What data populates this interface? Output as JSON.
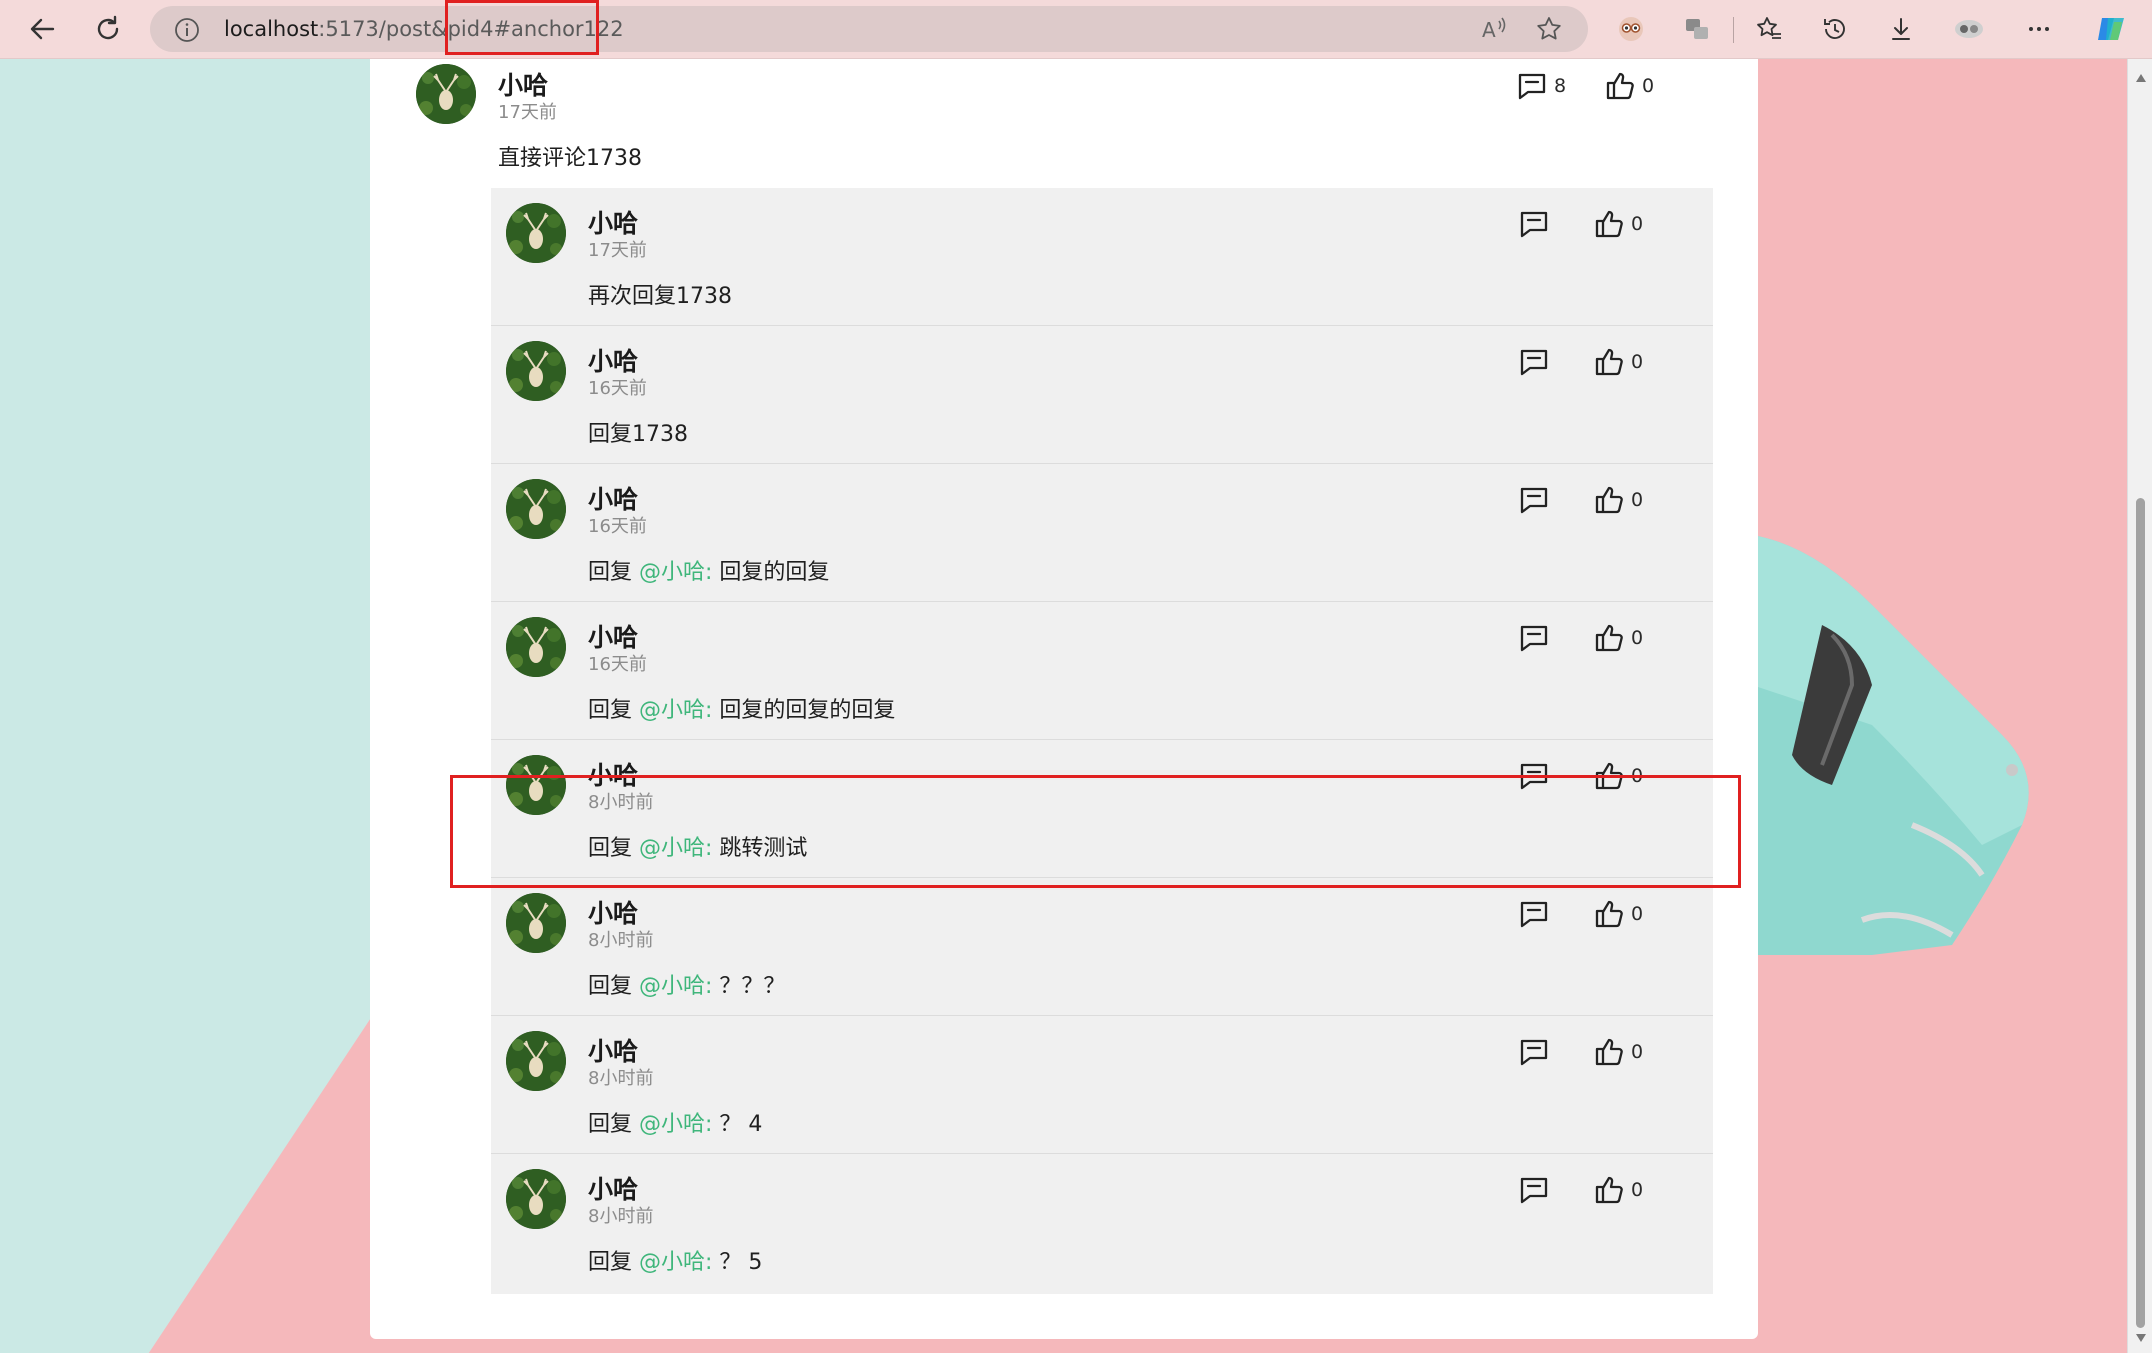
{
  "browser": {
    "url_host": "localhost",
    "url_path": ":5173/post&pid4#anchor122"
  },
  "main_comment": {
    "author": "小哈",
    "time": "17天前",
    "content": "直接评论1738",
    "reply_count": "8",
    "like_count": "0"
  },
  "replies": [
    {
      "author": "小哈",
      "time": "17天前",
      "prefix": "",
      "mention": "",
      "text": "再次回复1738",
      "likes": "0"
    },
    {
      "author": "小哈",
      "time": "16天前",
      "prefix": "",
      "mention": "",
      "text": "回复1738",
      "likes": "0"
    },
    {
      "author": "小哈",
      "time": "16天前",
      "prefix": "回复 ",
      "mention": "@小哈:",
      "text": " 回复的回复",
      "likes": "0"
    },
    {
      "author": "小哈",
      "time": "16天前",
      "prefix": "回复 ",
      "mention": "@小哈:",
      "text": " 回复的回复的回复",
      "likes": "0"
    },
    {
      "author": "小哈",
      "time": "8小时前",
      "prefix": "回复 ",
      "mention": "@小哈:",
      "text": " 跳转测试",
      "likes": "0"
    },
    {
      "author": "小哈",
      "time": "8小时前",
      "prefix": "回复 ",
      "mention": "@小哈:",
      "text": " ？？？",
      "likes": "0"
    },
    {
      "author": "小哈",
      "time": "8小时前",
      "prefix": "回复 ",
      "mention": "@小哈:",
      "text": " ？ 4",
      "likes": "0"
    },
    {
      "author": "小哈",
      "time": "8小时前",
      "prefix": "回复 ",
      "mention": "@小哈:",
      "text": " ？ 5",
      "likes": "0"
    }
  ],
  "colors": {
    "mention": "#3fb67b",
    "highlight": "#e02020",
    "bg_pink": "#f5b8bb",
    "bg_teal": "#cbe9e5"
  }
}
